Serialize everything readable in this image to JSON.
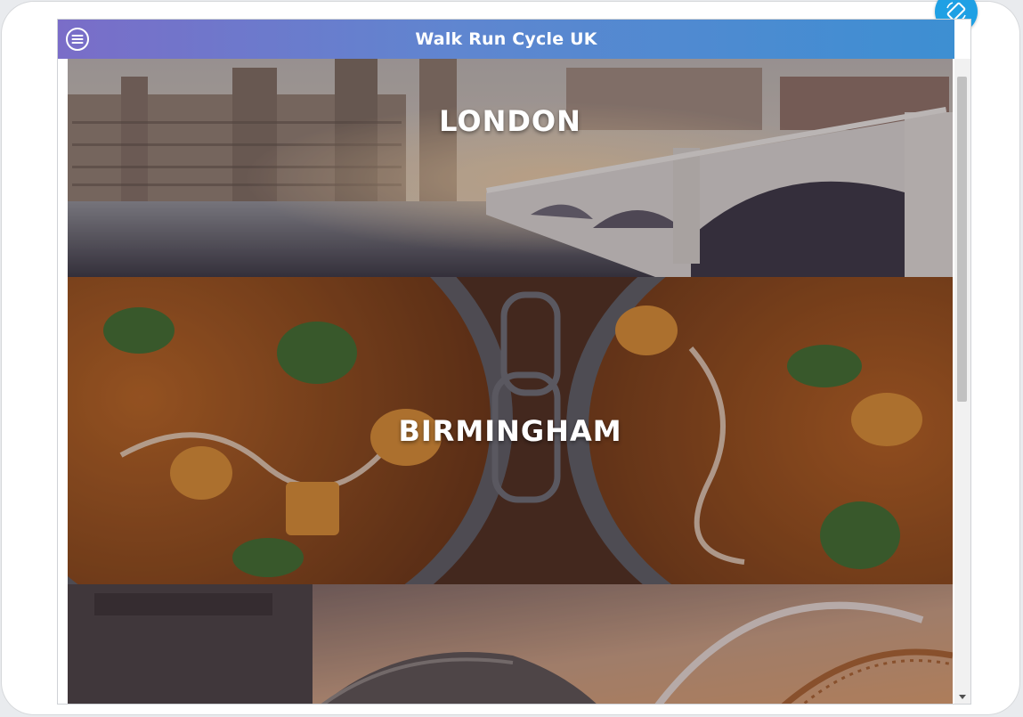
{
  "app": {
    "title": "Walk Run Cycle UK",
    "menu_icon": "hamburger-circle-icon",
    "rotate_icon": "rotate-device-icon"
  },
  "colors": {
    "header_start": "#7a6dc8",
    "header_end": "#3d8fd2",
    "rotate_button": "#1fa0e4",
    "city_text": "#ffffff"
  },
  "cities": [
    {
      "name": "LONDON",
      "image": "westminster-bridge-photo"
    },
    {
      "name": "BIRMINGHAM",
      "image": "curry-bowls-photo"
    },
    {
      "name": "",
      "image": "gateshead-millennium-bridge-photo"
    }
  ]
}
